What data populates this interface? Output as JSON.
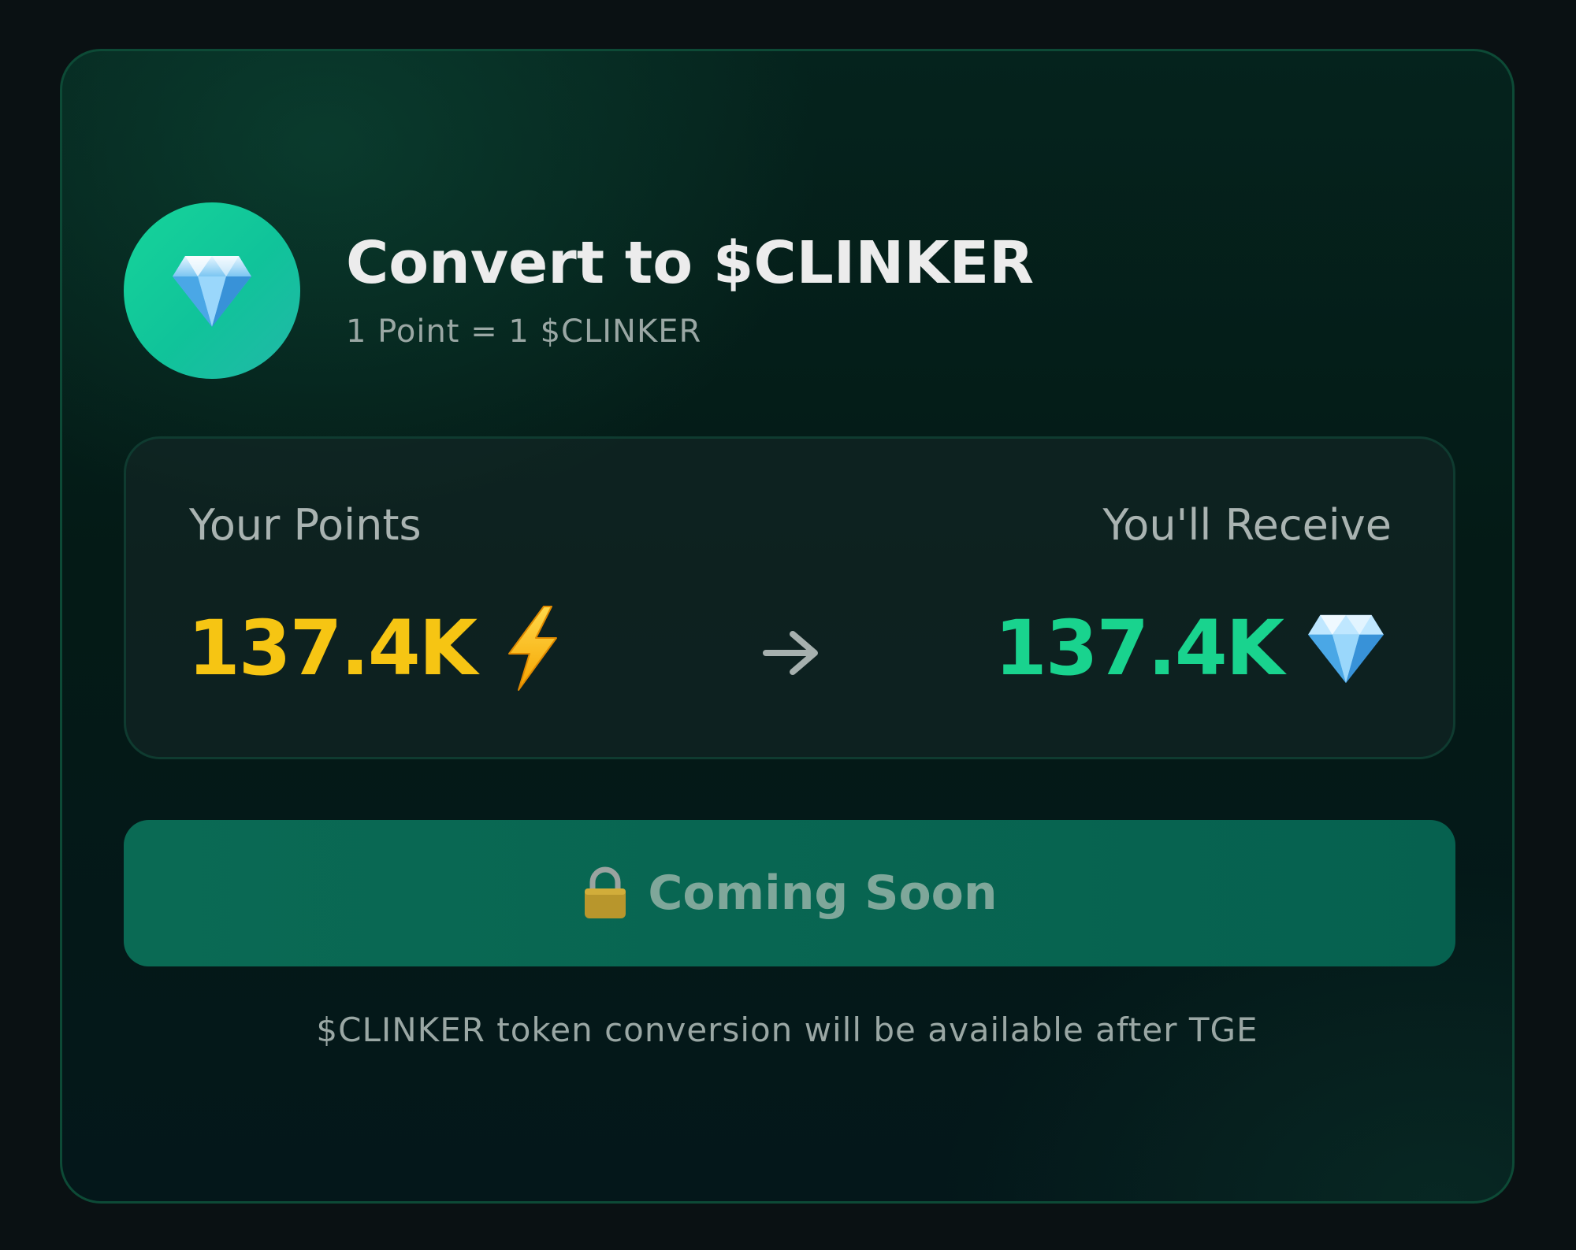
{
  "header": {
    "title": "Convert to $CLINKER",
    "rate": "1 Point = 1 $CLINKER",
    "icon": "diamond-icon"
  },
  "conversion": {
    "from_label": "Your Points",
    "from_value": "137.4K",
    "from_icon": "lightning-icon",
    "to_label": "You'll Receive",
    "to_value": "137.4K",
    "to_icon": "diamond-icon",
    "arrow_icon": "arrow-right-icon"
  },
  "cta": {
    "label": "Coming Soon",
    "icon": "lock-icon"
  },
  "footnote": "$CLINKER token conversion will be available after TGE",
  "colors": {
    "background": "#0a1113",
    "card_border": "#0d4a36",
    "points_value": "#f6c513",
    "receive_value": "#19d38e",
    "button": "#0a6a54"
  }
}
